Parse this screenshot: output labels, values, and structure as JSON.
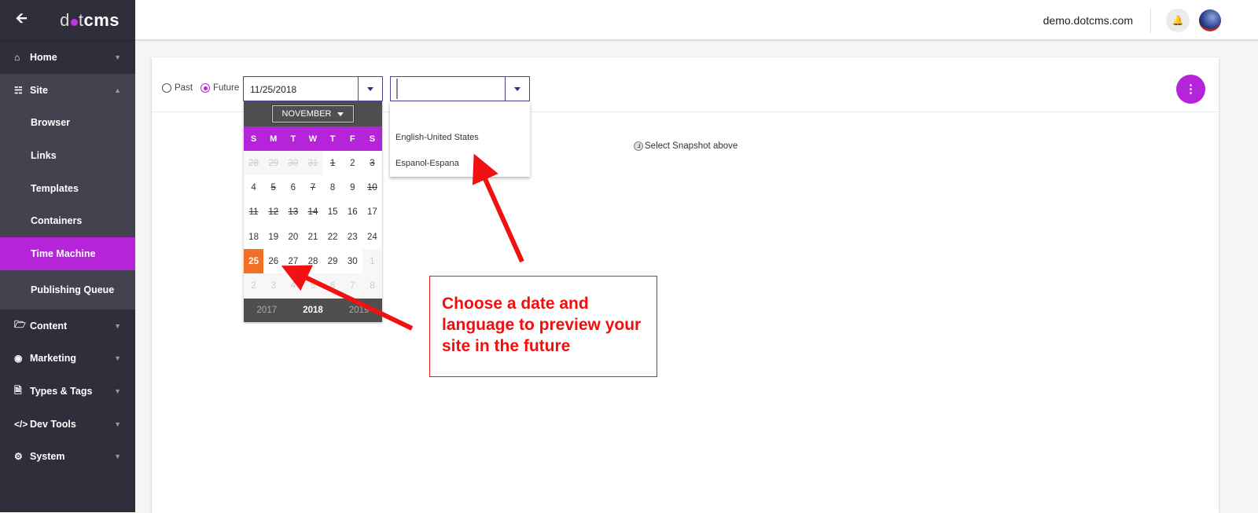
{
  "sidebar": {
    "logo": "dotcms",
    "items": [
      {
        "label": "Home",
        "icon": "home-icon"
      },
      {
        "label": "Site",
        "icon": "sitemap-icon",
        "expanded": true,
        "children": [
          "Browser",
          "Links",
          "Templates",
          "Containers",
          "Time Machine",
          "Publishing Queue"
        ],
        "active": "Time Machine"
      },
      {
        "label": "Content",
        "icon": "folder-icon"
      },
      {
        "label": "Marketing",
        "icon": "target-icon"
      },
      {
        "label": "Types & Tags",
        "icon": "file-icon"
      },
      {
        "label": "Dev Tools",
        "icon": "code-icon"
      },
      {
        "label": "System",
        "icon": "gear-icon"
      }
    ]
  },
  "header": {
    "host": "demo.dotcms.com"
  },
  "toolbar": {
    "past_label": "Past",
    "future_label": "Future",
    "selected": "Future",
    "date_value": "11/25/2018",
    "language_value": ""
  },
  "language_options": [
    "English-United States",
    "Espanol-Espana"
  ],
  "snapshot_text": "Select Snapshot above",
  "calendar": {
    "month": "NOVEMBER",
    "weekdays": [
      "S",
      "M",
      "T",
      "W",
      "T",
      "F",
      "S"
    ],
    "days": [
      {
        "d": "28",
        "other": true,
        "struck": true
      },
      {
        "d": "29",
        "other": true,
        "struck": true
      },
      {
        "d": "30",
        "other": true,
        "struck": true
      },
      {
        "d": "31",
        "other": true,
        "struck": true
      },
      {
        "d": "1",
        "struck": true
      },
      {
        "d": "2"
      },
      {
        "d": "3",
        "struck": true
      },
      {
        "d": "4"
      },
      {
        "d": "5",
        "struck": true
      },
      {
        "d": "6"
      },
      {
        "d": "7",
        "struck": true
      },
      {
        "d": "8"
      },
      {
        "d": "9"
      },
      {
        "d": "10",
        "struck": true
      },
      {
        "d": "11",
        "struck": true
      },
      {
        "d": "12",
        "struck": true
      },
      {
        "d": "13",
        "struck": true
      },
      {
        "d": "14",
        "struck": true
      },
      {
        "d": "15"
      },
      {
        "d": "16"
      },
      {
        "d": "17"
      },
      {
        "d": "18"
      },
      {
        "d": "19"
      },
      {
        "d": "20"
      },
      {
        "d": "21"
      },
      {
        "d": "22"
      },
      {
        "d": "23"
      },
      {
        "d": "24"
      },
      {
        "d": "25",
        "selected": true
      },
      {
        "d": "26"
      },
      {
        "d": "27"
      },
      {
        "d": "28"
      },
      {
        "d": "29"
      },
      {
        "d": "30"
      },
      {
        "d": "1",
        "other": true
      },
      {
        "d": "2",
        "other": true
      },
      {
        "d": "3",
        "other": true
      },
      {
        "d": "4",
        "other": true
      },
      {
        "d": "5",
        "other": true
      },
      {
        "d": "6",
        "other": true
      },
      {
        "d": "7",
        "other": true
      },
      {
        "d": "8",
        "other": true
      }
    ],
    "years": [
      "2017",
      "2018",
      "2019"
    ],
    "current_year": "2018"
  },
  "annotation": {
    "text": "Choose a date and language to preview your site in the future",
    "color": "#f40d0d"
  },
  "colors": {
    "accent": "#b524d9",
    "selected_day": "#f07125",
    "sidebar": "#2f2e3b"
  }
}
